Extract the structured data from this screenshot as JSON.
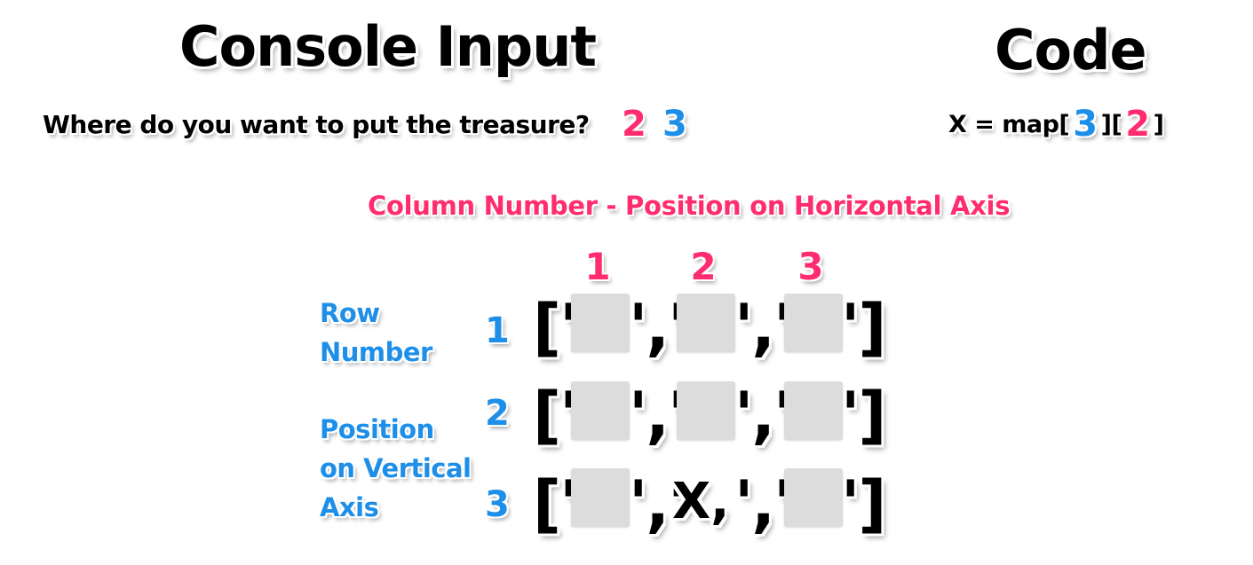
{
  "console": {
    "title": "Console Input",
    "prompt": "Where do you want to put the treasure?",
    "input_column": "2",
    "input_row": "3"
  },
  "code": {
    "title": "Code",
    "prefix": "X = map[",
    "row_index": "3",
    "middle": "][",
    "col_index": "2",
    "suffix": "]"
  },
  "grid": {
    "column_caption": "Column Number - Position on Horizontal Axis",
    "column_numbers": [
      "1",
      "2",
      "3"
    ],
    "row_caption_top": [
      "Row",
      "Number"
    ],
    "row_caption_bottom": [
      "Position",
      "on Vertical",
      "Axis"
    ],
    "row_numbers": [
      "1",
      "2",
      "3"
    ],
    "open_bracket": "['",
    "separator": "','",
    "close_bracket": "']",
    "marker": "X,",
    "rows": [
      [
        "",
        "",
        ""
      ],
      [
        "",
        "",
        ""
      ],
      [
        "",
        "X,",
        ""
      ]
    ]
  },
  "colors": {
    "column_accent": "#ff2d6f",
    "row_accent": "#1e8fe8",
    "cell_fill": "#dcdcdc"
  }
}
